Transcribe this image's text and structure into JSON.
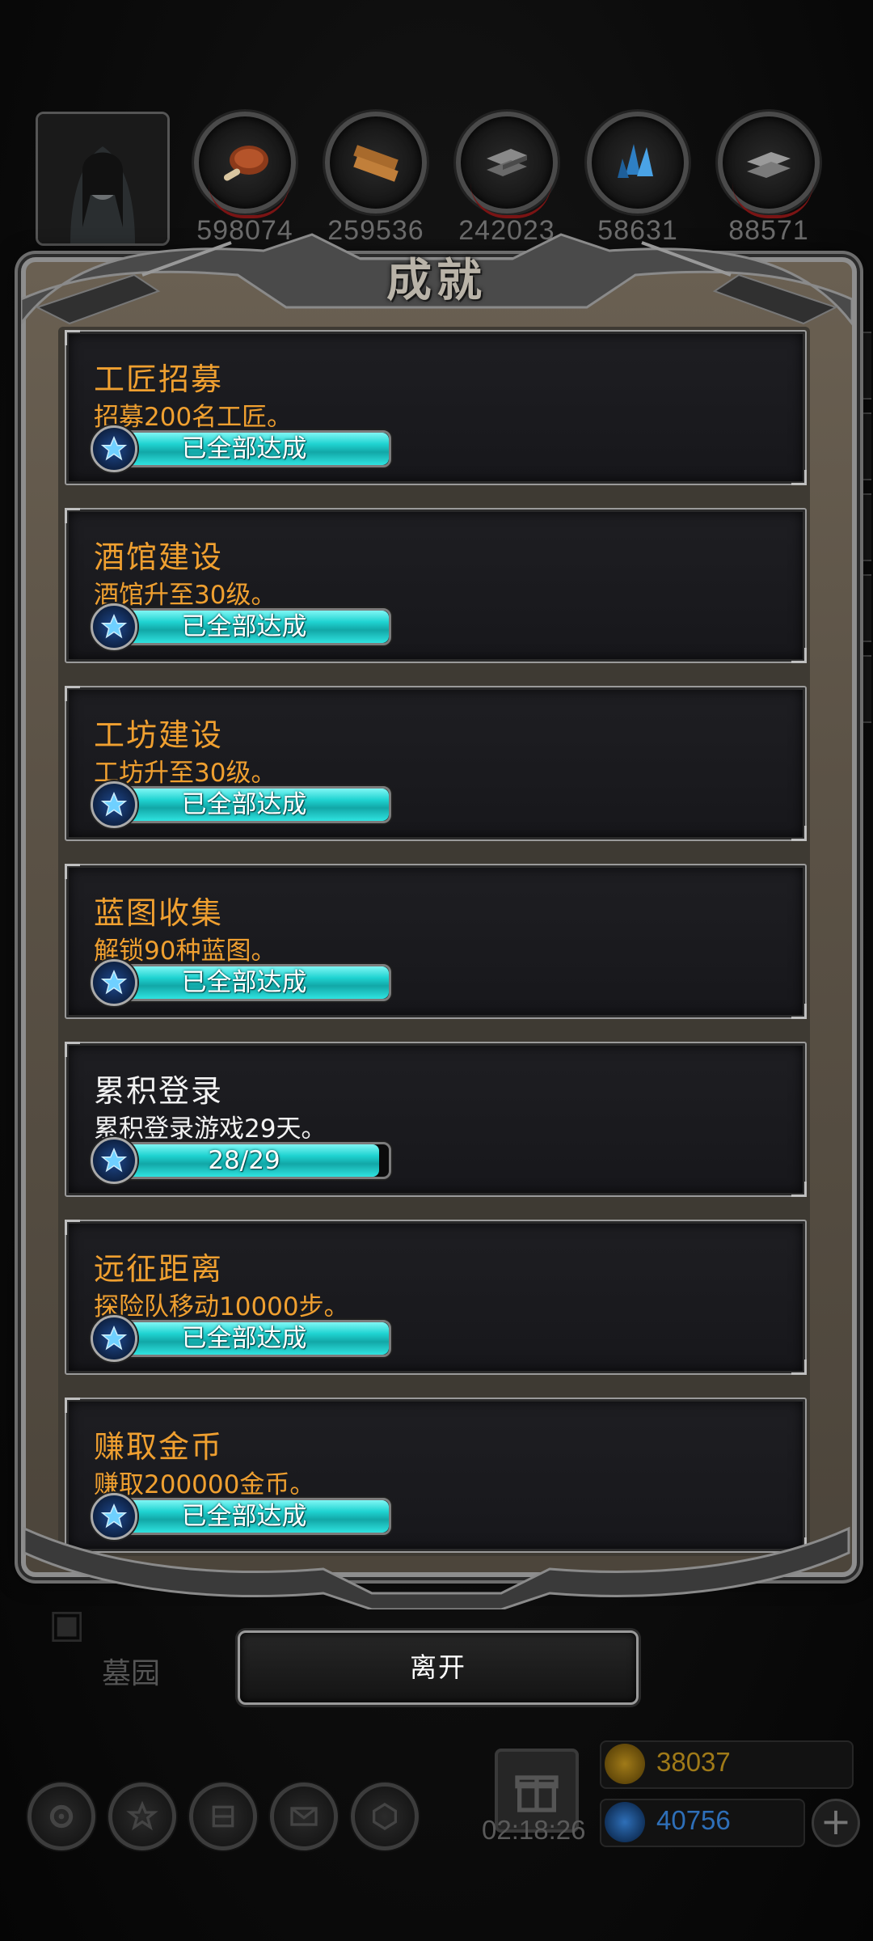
{
  "top_bar": {
    "resources": [
      {
        "icon": "meat-icon",
        "count": "598074"
      },
      {
        "icon": "wood-icon",
        "count": "259536"
      },
      {
        "icon": "iron-icon",
        "count": "242023"
      },
      {
        "icon": "crystal-icon",
        "count": "58631"
      },
      {
        "icon": "steel-icon",
        "count": "88571"
      }
    ]
  },
  "dialog": {
    "title": "成就",
    "achievements": [
      {
        "name": "工匠招募",
        "desc": "招募200名工匠。",
        "progress_label": "已全部达成",
        "progress": 1.0,
        "completed": true
      },
      {
        "name": "酒馆建设",
        "desc": "酒馆升至30级。",
        "progress_label": "已全部达成",
        "progress": 1.0,
        "completed": true
      },
      {
        "name": "工坊建设",
        "desc": "工坊升至30级。",
        "progress_label": "已全部达成",
        "progress": 1.0,
        "completed": true
      },
      {
        "name": "蓝图收集",
        "desc": "解锁90种蓝图。",
        "progress_label": "已全部达成",
        "progress": 1.0,
        "completed": true
      },
      {
        "name": "累积登录",
        "desc": "累积登录游戏29天。",
        "progress_label": "28/29",
        "progress": 0.9655,
        "completed": false
      },
      {
        "name": "远征距离",
        "desc": "探险队移动10000步。",
        "progress_label": "已全部达成",
        "progress": 1.0,
        "completed": true
      },
      {
        "name": "赚取金币",
        "desc": "赚取200000金币。",
        "progress_label": "已全部达成",
        "progress": 1.0,
        "completed": true
      }
    ],
    "leave_label": "离开"
  },
  "background": {
    "location_label": "墓园"
  },
  "bottom_bar": {
    "timer": "02:18:26",
    "gold": "38037",
    "gems": "40756",
    "plus": "+"
  },
  "colors": {
    "accent_orange": "#f0a030",
    "progress_cyan": "#1fd3d1",
    "gold_text": "#a07a18",
    "gem_text": "#2e6fb8"
  }
}
